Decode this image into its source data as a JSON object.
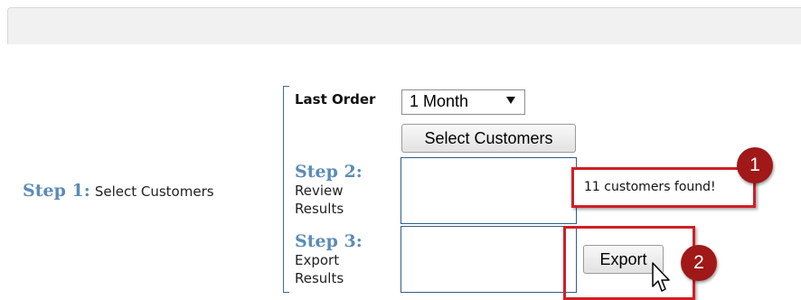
{
  "step1": {
    "label": "Step 1:",
    "text": "Select Customers"
  },
  "filter": {
    "label": "Last Order",
    "selected": "1 Month"
  },
  "buttons": {
    "select_customers": "Select Customers",
    "export": "Export"
  },
  "step2": {
    "label": "Step 2:",
    "line1": "Review",
    "line2": "Results"
  },
  "step3": {
    "label": "Step 3:",
    "line1": "Export",
    "line2": "Results"
  },
  "status": {
    "found": "11 customers found!"
  },
  "callouts": {
    "one": "1",
    "two": "2"
  },
  "colors": {
    "step_heading": "#5b8bb5",
    "callout_red": "#d01f25",
    "badge": "#a01818"
  }
}
